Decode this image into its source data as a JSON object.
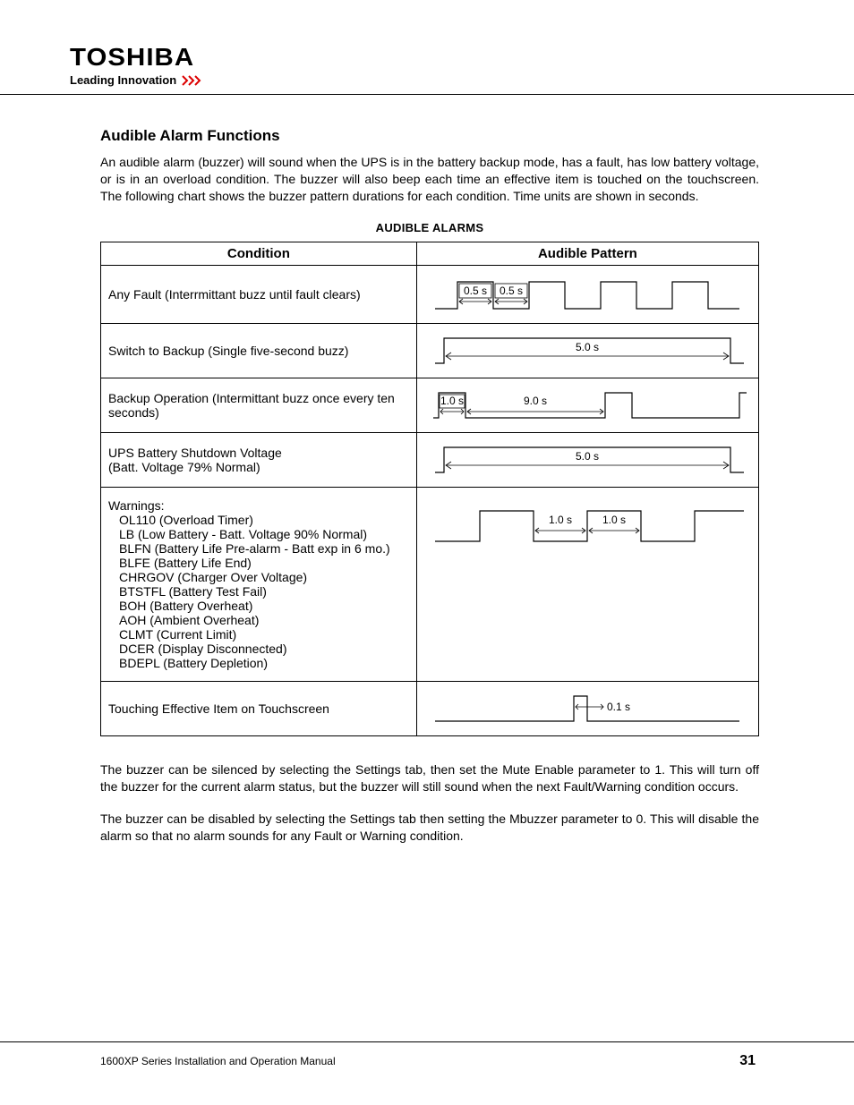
{
  "header": {
    "brand": "TOSHIBA",
    "tagline": "Leading Innovation"
  },
  "section": {
    "title": "Audible Alarm Functions",
    "intro": "An audible alarm (buzzer) will sound when the UPS is in the battery backup mode, has a fault, has low battery voltage, or is in an overload condition. The buzzer will also beep each time an effective item is touched on the touchscreen. The following chart shows the buzzer pattern durations for each condition. Time units are shown in seconds.",
    "table_caption": "AUDIBLE ALARMS",
    "col_condition": "Condition",
    "col_pattern": "Audible Pattern",
    "rows": {
      "r0": {
        "cond": "Any Fault (Interrmittant buzz until fault clears)",
        "lab_a": "0.5 s",
        "lab_b": "0.5 s"
      },
      "r1": {
        "cond": "Switch to Backup (Single five-second buzz)",
        "lab_a": "5.0 s"
      },
      "r2": {
        "cond": "Backup Operation (Intermittant buzz once every ten seconds)",
        "lab_a": "1.0 s",
        "lab_b": "9.0 s"
      },
      "r3": {
        "cond_l1": "UPS Battery Shutdown Voltage",
        "cond_l2": "(Batt. Voltage 79% Normal)",
        "lab_a": "5.0 s"
      },
      "r4": {
        "header": "Warnings:",
        "w0": "OL110 (Overload Timer)",
        "w1": "LB (Low Battery - Batt. Voltage 90% Normal)",
        "w2": "BLFN (Battery Life Pre-alarm - Batt exp in 6 mo.)",
        "w3": "BLFE (Battery Life End)",
        "w4": "CHRGOV (Charger Over Voltage)",
        "w5": "BTSTFL (Battery Test Fail)",
        "w6": "BOH (Battery Overheat)",
        "w7": "AOH (Ambient Overheat)",
        "w8": "CLMT (Current Limit)",
        "w9": "DCER (Display Disconnected)",
        "w10": "BDEPL (Battery Depletion)",
        "lab_a": "1.0 s",
        "lab_b": "1.0 s"
      },
      "r5": {
        "cond": "Touching Effective Item on Touchscreen",
        "lab_a": "0.1 s"
      }
    },
    "para2": "The buzzer can be silenced by selecting the Settings tab, then set the Mute Enable parameter to 1.  This will turn off the buzzer for the current alarm status, but the buzzer will still sound when the next Fault/Warning condition occurs.",
    "para3": "The buzzer can be disabled by selecting the Settings tab then setting the Mbuzzer parameter to 0.  This will disable the alarm so that no alarm sounds for any Fault or Warning condition."
  },
  "footer": {
    "left": "1600XP Series Installation and Operation Manual",
    "page": "31"
  }
}
